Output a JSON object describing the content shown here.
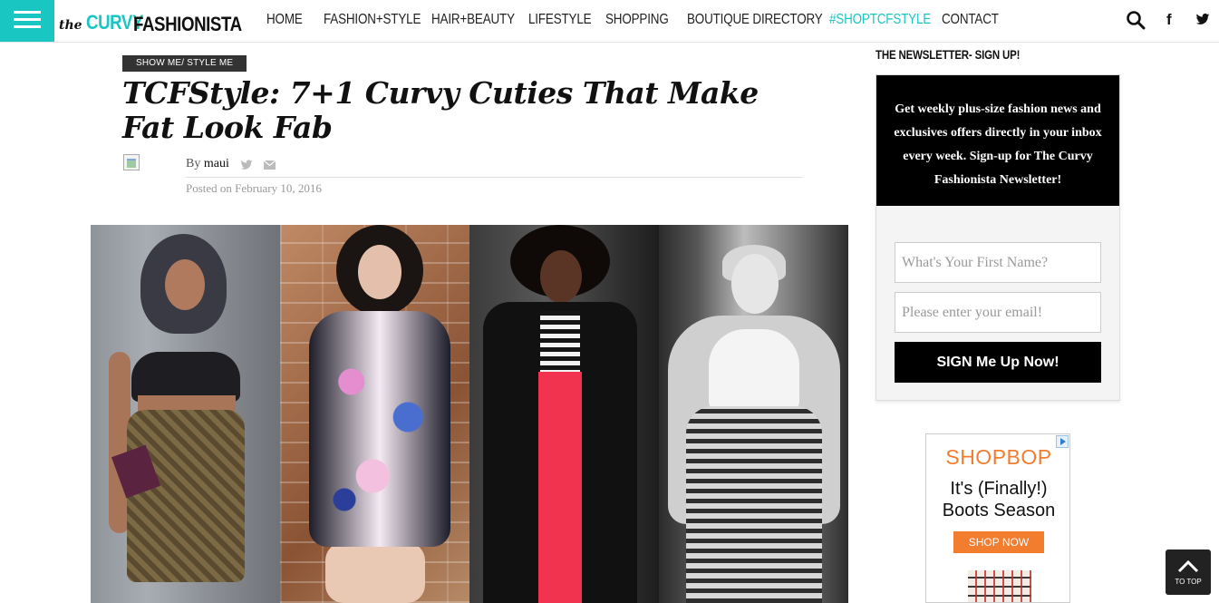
{
  "site": {
    "logo_the": "the",
    "logo_curvy": "CURVY",
    "logo_fashionista": "FASHIONISTA"
  },
  "nav": {
    "items": [
      {
        "label": "HOME"
      },
      {
        "label": "FASHION+STYLE"
      },
      {
        "label": "HAIR+BEAUTY"
      },
      {
        "label": "LIFESTYLE"
      },
      {
        "label": "SHOPPING"
      },
      {
        "label": "BOUTIQUE DIRECTORY"
      },
      {
        "label": "#SHOPTCFSTYLE"
      },
      {
        "label": "CONTACT"
      }
    ],
    "accent_color": "#1ac6c2"
  },
  "article": {
    "category": "SHOW ME/ STYLE ME",
    "title": "TCFStyle: 7+1 Curvy Cuties That Make Fat Look Fab",
    "by_prefix": "By",
    "author": "maui",
    "posted": "Posted on February 10, 2016"
  },
  "sidebar": {
    "heading": "THE NEWSLETTER- SIGN UP!",
    "signup_text": "Get weekly plus-size fashion news and exclusives offers directly in your inbox every week. Sign-up for The Curvy Fashionista Newsletter!",
    "first_name_placeholder": "What's Your First Name?",
    "email_placeholder": "Please enter your email!",
    "button_label": "SIGN Me Up Now!"
  },
  "ad": {
    "brand": "SHOPBOP",
    "copy_line1": "It's (Finally!)",
    "copy_line2": "Boots Season",
    "cta": "SHOP NOW",
    "brand_color": "#f27d2f"
  },
  "to_top": {
    "label": "TO TOP"
  }
}
